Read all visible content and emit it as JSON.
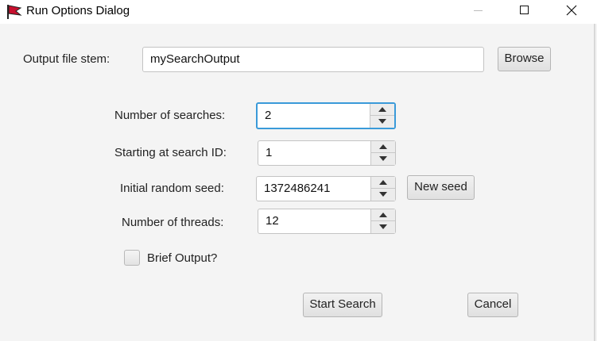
{
  "window": {
    "title": "Run Options Dialog",
    "app_icon": "red-flag-icon"
  },
  "form": {
    "output_stem_label": "Output file stem:",
    "output_stem_value": "mySearchOutput",
    "browse_label": "Browse",
    "num_searches_label": "Number of searches:",
    "num_searches_value": "2",
    "start_id_label": "Starting at search ID:",
    "start_id_value": "1",
    "seed_label": "Initial random seed:",
    "seed_value": "1372486241",
    "new_seed_label": "New seed",
    "threads_label": "Number of threads:",
    "threads_value": "12",
    "brief_output_label": "Brief Output?",
    "brief_output_checked": false
  },
  "actions": {
    "start_label": "Start Search",
    "cancel_label": "Cancel"
  },
  "colors": {
    "focus_accent": "#3a9ad9",
    "dialog_background": "#f4f4f4"
  }
}
